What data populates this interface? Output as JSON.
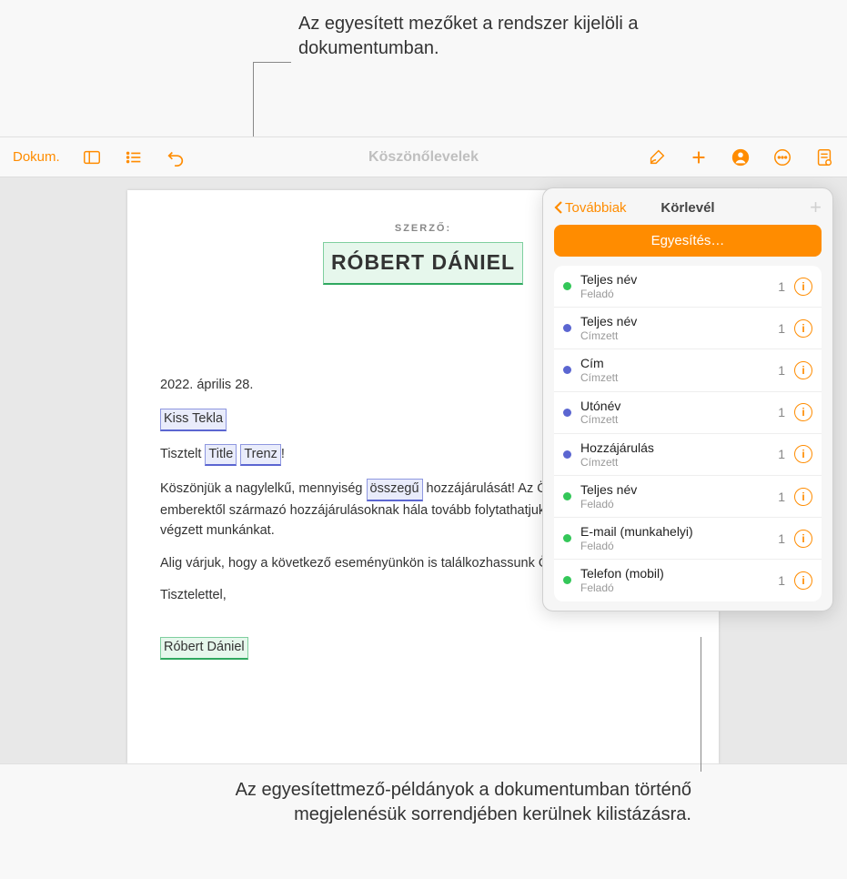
{
  "annotations": {
    "top": "Az egyesített mezőket a rendszer kijelöli a dokumentumban.",
    "bottom": "Az egyesítettmező-példányok a dokumentumban történő megjelenésük sorrendjében kerülnek kilistázásra."
  },
  "toolbar": {
    "documents_label": "Dokum.",
    "title": "Köszönőlevelek"
  },
  "document": {
    "author_label": "SZERZŐ:",
    "author_name": "RÓBERT DÁNIEL",
    "date": "2022. április 28.",
    "recipient_name": "Kiss Tekla",
    "salutation_prefix": "Tisztelt ",
    "field_title": "Title",
    "field_trenz": "Trenz",
    "salutation_suffix": "!",
    "body1_a": "Köszönjük a nagylelkű, mennyiség ",
    "field_amount": "összegű",
    "body1_b": " hozzájárulását! Az Önhöz hasonló emberektől származó hozzájárulásoknak hála tovább folytathatjuk közösségünkért végzett munkánkat.",
    "body2": "Alig várjuk, hogy a következő eseményünkön is találkozhassunk Önnel!",
    "closing": "Tisztelettel,",
    "signature": "Róbert Dániel"
  },
  "popover": {
    "back_label": "Továbbiak",
    "title": "Körlevél",
    "merge_button": "Egyesítés…",
    "info_glyph": "i",
    "fields": [
      {
        "name": "Teljes név",
        "role": "Feladó",
        "count": 1,
        "color": "green"
      },
      {
        "name": "Teljes név",
        "role": "Címzett",
        "count": 1,
        "color": "blue"
      },
      {
        "name": "Cím",
        "role": "Címzett",
        "count": 1,
        "color": "blue"
      },
      {
        "name": "Utónév",
        "role": "Címzett",
        "count": 1,
        "color": "blue"
      },
      {
        "name": "Hozzájárulás",
        "role": "Címzett",
        "count": 1,
        "color": "blue"
      },
      {
        "name": "Teljes név",
        "role": "Feladó",
        "count": 1,
        "color": "green"
      },
      {
        "name": "E-mail (munkahelyi)",
        "role": "Feladó",
        "count": 1,
        "color": "green"
      },
      {
        "name": "Telefon (mobil)",
        "role": "Feladó",
        "count": 1,
        "color": "green"
      }
    ]
  }
}
